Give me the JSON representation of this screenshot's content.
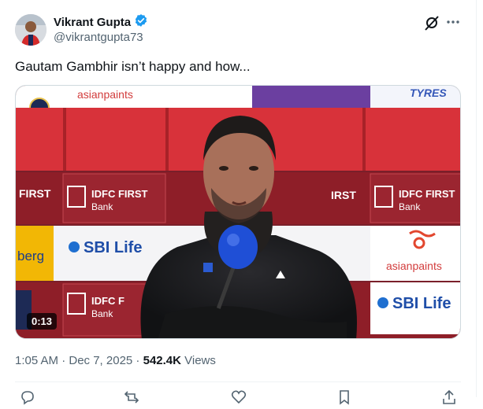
{
  "author": {
    "name": "Vikrant Gupta",
    "handle": "@vikrantgupta73"
  },
  "tweet": {
    "text": "Gautam Gambhir isn’t happy and how...",
    "timestamp": "1:05 AM · Dec 7, 2025",
    "separator": " · ",
    "views_count": "542.4K",
    "views_label": " Views"
  },
  "video": {
    "duration": "0:13",
    "backdrop_texts": {
      "asianpaints_top": "asianpaints",
      "tyres": "TYRES",
      "first_left": "FIRST",
      "idfc_1": "IDFC FIRST",
      "bank_1": "Bank",
      "first_right": "IRST",
      "idfc_2": "IDFC FIRST",
      "bank_2": "Bank",
      "sbi_1": "SBI Life",
      "berg": "berg",
      "asianpaints_right": "asianpaints",
      "sbi_2": "SBI Life",
      "idfc_3": "IDFC F",
      "bank_3": "Bank"
    }
  },
  "icons": {
    "verified": "verified-badge-icon",
    "grok": "grok-icon",
    "more": "more-icon"
  },
  "colors": {
    "accent": "#1d9bf0",
    "secondary_text": "#536471",
    "backdrop_red": "#d8323a"
  }
}
